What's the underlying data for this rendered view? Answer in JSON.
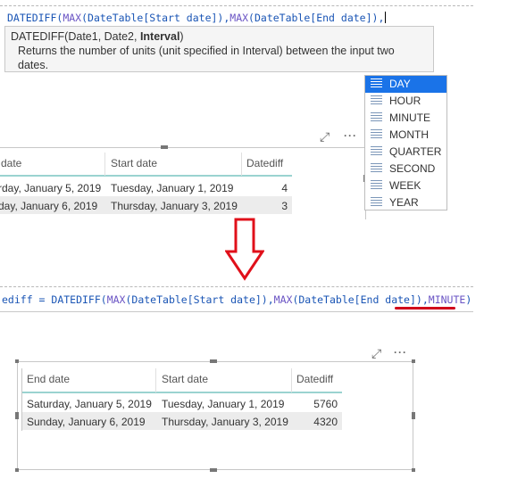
{
  "formula_top": {
    "fn": "DATEDIFF(",
    "max1": "MAX",
    "arg1": "(DateTable[Start date]),",
    "max2": "MAX",
    "arg2": "(DateTable[End date]),"
  },
  "tooltip": {
    "sig_prefix": "DATEDIFF(Date1, Date2, ",
    "sig_bold": "Interval",
    "sig_suffix": ")",
    "description_line1": "Returns the number of units (unit specified in Interval) between the input two",
    "description_line2": "dates."
  },
  "interval_options": [
    "DAY",
    "HOUR",
    "MINUTE",
    "MONTH",
    "QUARTER",
    "SECOND",
    "WEEK",
    "YEAR"
  ],
  "selected_interval": "DAY",
  "table_top": {
    "columns": [
      "date",
      "Start date",
      "Datediff"
    ],
    "rows": [
      [
        "rday, January 5, 2019",
        "Tuesday, January 1, 2019",
        "4"
      ],
      [
        "day, January 6, 2019",
        "Thursday, January 3, 2019",
        "3"
      ]
    ]
  },
  "formula_bottom": {
    "prefix": "ediff = ",
    "fn": "DATEDIFF(",
    "max1": "MAX",
    "arg1": "(DateTable[Start date]),",
    "max2": "MAX",
    "arg2": "(DateTable[End date]),",
    "interval": "MINUTE",
    "close": ")"
  },
  "table_bottom": {
    "columns": [
      "End date",
      "Start date",
      "Datediff"
    ],
    "rows": [
      [
        "Saturday, January 5, 2019",
        "Tuesday, January 1, 2019",
        "5760"
      ],
      [
        "Sunday, January 6, 2019",
        "Thursday, January 3, 2019",
        "4320"
      ]
    ]
  },
  "icons": {
    "focus": "⤢",
    "more": "···"
  },
  "colors": {
    "accent_header_line": "#9ad3d0",
    "arrow": "#e0101a",
    "selected_option": "#1a73e8",
    "keyword": "#1a55b5"
  }
}
